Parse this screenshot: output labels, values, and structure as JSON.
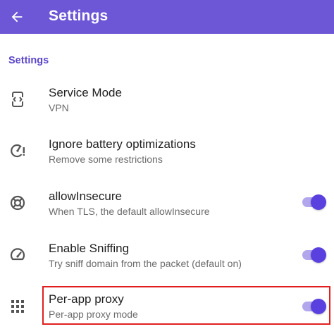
{
  "appbar": {
    "title": "Settings",
    "back_icon": "arrow-back-icon",
    "color": "#6d57d6"
  },
  "section": {
    "title": "Settings",
    "color": "#5a46c9"
  },
  "items": [
    {
      "icon": "service-mode-icon",
      "title": "Service Mode",
      "subtitle": "VPN",
      "has_switch": false
    },
    {
      "icon": "battery-alert-icon",
      "title": "Ignore battery optimizations",
      "subtitle": "Remove some restrictions",
      "has_switch": false
    },
    {
      "icon": "lifebuoy-icon",
      "title": "allowInsecure",
      "subtitle": "When TLS, the default allowInsecure",
      "has_switch": true,
      "checked": true
    },
    {
      "icon": "speedometer-icon",
      "title": "Enable Sniffing",
      "subtitle": "Try sniff domain from the packet (default on)",
      "has_switch": true,
      "checked": true
    },
    {
      "icon": "apps-grid-icon",
      "title": "Per-app proxy",
      "subtitle": "Per-app proxy mode",
      "has_switch": true,
      "checked": true,
      "highlighted": true
    }
  ],
  "colors": {
    "switch_thumb": "#5b40e0",
    "switch_track": "#b2a6ec",
    "highlight_border": "#e0201f"
  }
}
